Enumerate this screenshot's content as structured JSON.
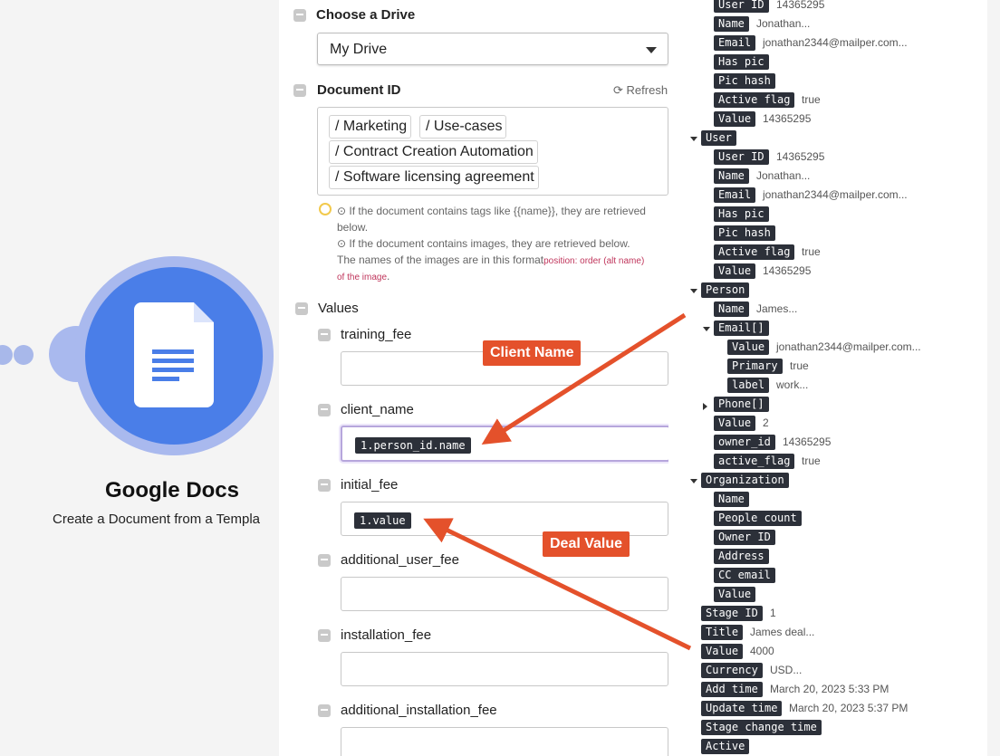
{
  "canvas": {
    "app_title": "Google Docs",
    "app_subtitle": "Create a Document from a Templa"
  },
  "form": {
    "choose_drive_label": "Choose a Drive",
    "drive_value": "My Drive",
    "document_id_label": "Document ID",
    "refresh_label": "Refresh",
    "path": [
      "Marketing",
      "Use-cases",
      "Contract Creation Automation",
      "Software licensing agreement"
    ],
    "hints": {
      "line1": "If the document contains tags like {{name}}, they are retrieved",
      "line2": "below.",
      "line3": "If the document contains images, they are retrieved below.",
      "line4": "The names of the images are in this format",
      "line4_red": "position: order (alt name)",
      "line5_red": "of the image",
      "line5_end": "."
    },
    "values_label": "Values",
    "fields": [
      {
        "label": "training_fee",
        "value": ""
      },
      {
        "label": "client_name",
        "value": "1.person_id.name"
      },
      {
        "label": "initial_fee",
        "value": "1.value"
      },
      {
        "label": "additional_user_fee",
        "value": ""
      },
      {
        "label": "installation_fee",
        "value": ""
      },
      {
        "label": "additional_installation_fee",
        "value": ""
      }
    ]
  },
  "tree": {
    "rows": [
      {
        "key": "User ID",
        "value": "14365295"
      },
      {
        "key": "Name",
        "value": "Jonathan..."
      },
      {
        "key": "Email",
        "value": "jonathan2344@mailper.com..."
      },
      {
        "key": "Has pic",
        "value": ""
      },
      {
        "key": "Pic hash",
        "value": ""
      },
      {
        "key": "Active flag",
        "value": "true"
      },
      {
        "key": "Value",
        "value": "14365295"
      },
      {
        "key": "User",
        "value": "",
        "expanded": true
      },
      {
        "key": "User ID",
        "value": "14365295"
      },
      {
        "key": "Name",
        "value": "Jonathan..."
      },
      {
        "key": "Email",
        "value": "jonathan2344@mailper.com..."
      },
      {
        "key": "Has pic",
        "value": ""
      },
      {
        "key": "Pic hash",
        "value": ""
      },
      {
        "key": "Active flag",
        "value": "true"
      },
      {
        "key": "Value",
        "value": "14365295"
      },
      {
        "key": "Person",
        "value": "",
        "expanded": true
      },
      {
        "key": "Name",
        "value": "James..."
      },
      {
        "key": "Email[]",
        "value": "",
        "expanded": true
      },
      {
        "key": "Value",
        "value": "jonathan2344@mailper.com..."
      },
      {
        "key": "Primary",
        "value": "true"
      },
      {
        "key": "label",
        "value": "work..."
      },
      {
        "key": "Phone[]",
        "value": "",
        "expanded": false
      },
      {
        "key": "Value",
        "value": "2"
      },
      {
        "key": "owner_id",
        "value": "14365295"
      },
      {
        "key": "active_flag",
        "value": "true"
      },
      {
        "key": "Organization",
        "value": "",
        "expanded": true
      },
      {
        "key": "Name",
        "value": ""
      },
      {
        "key": "People count",
        "value": ""
      },
      {
        "key": "Owner ID",
        "value": ""
      },
      {
        "key": "Address",
        "value": ""
      },
      {
        "key": "CC email",
        "value": ""
      },
      {
        "key": "Value",
        "value": ""
      },
      {
        "key": "Stage ID",
        "value": "1"
      },
      {
        "key": "Title",
        "value": "James deal..."
      },
      {
        "key": "Value",
        "value": "4000"
      },
      {
        "key": "Currency",
        "value": "USD..."
      },
      {
        "key": "Add time",
        "value": "March 20, 2023 5:33 PM"
      },
      {
        "key": "Update time",
        "value": "March 20, 2023 5:37 PM"
      },
      {
        "key": "Stage change time",
        "value": ""
      },
      {
        "key": "Active",
        "value": ""
      }
    ]
  },
  "annotations": {
    "client_name_callout": "Client Name",
    "deal_value_callout": "Deal Value",
    "color": "#e4512b"
  }
}
